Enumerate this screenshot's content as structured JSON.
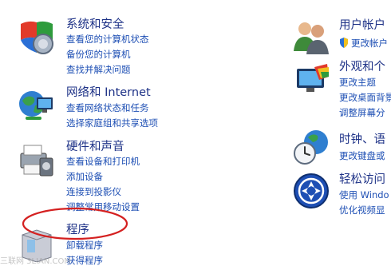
{
  "left_column": {
    "system_security": {
      "title": "系统和安全",
      "links": [
        "查看您的计算机状态",
        "备份您的计算机",
        "查找并解决问题"
      ]
    },
    "network_internet": {
      "title": "网络和 Internet",
      "links": [
        "查看网络状态和任务",
        "选择家庭组和共享选项"
      ]
    },
    "hardware_sound": {
      "title": "硬件和声音",
      "links": [
        "查看设备和打印机",
        "添加设备",
        "连接到投影仪",
        "调整常用移动设置"
      ]
    },
    "programs": {
      "title": "程序",
      "links": [
        "卸载程序",
        "获得程序"
      ]
    }
  },
  "right_column": {
    "user_accounts": {
      "title": "用户帐户",
      "links": [
        "更改帐户"
      ]
    },
    "appearance": {
      "title": "外观和个",
      "links": [
        "更改主题",
        "更改桌面背景",
        "调整屏幕分"
      ]
    },
    "clock_region": {
      "title": "时钟、语",
      "links": [
        "更改键盘或"
      ]
    },
    "ease_of_access": {
      "title": "轻松访问",
      "links": [
        "使用 Windo",
        "优化视频显"
      ]
    }
  },
  "annotation": {
    "color": "#d42020"
  },
  "watermark": {
    "text": "三联网 3LIAN.COM"
  },
  "colors": {
    "title": "#1e3287",
    "link": "#1e4fb4"
  }
}
